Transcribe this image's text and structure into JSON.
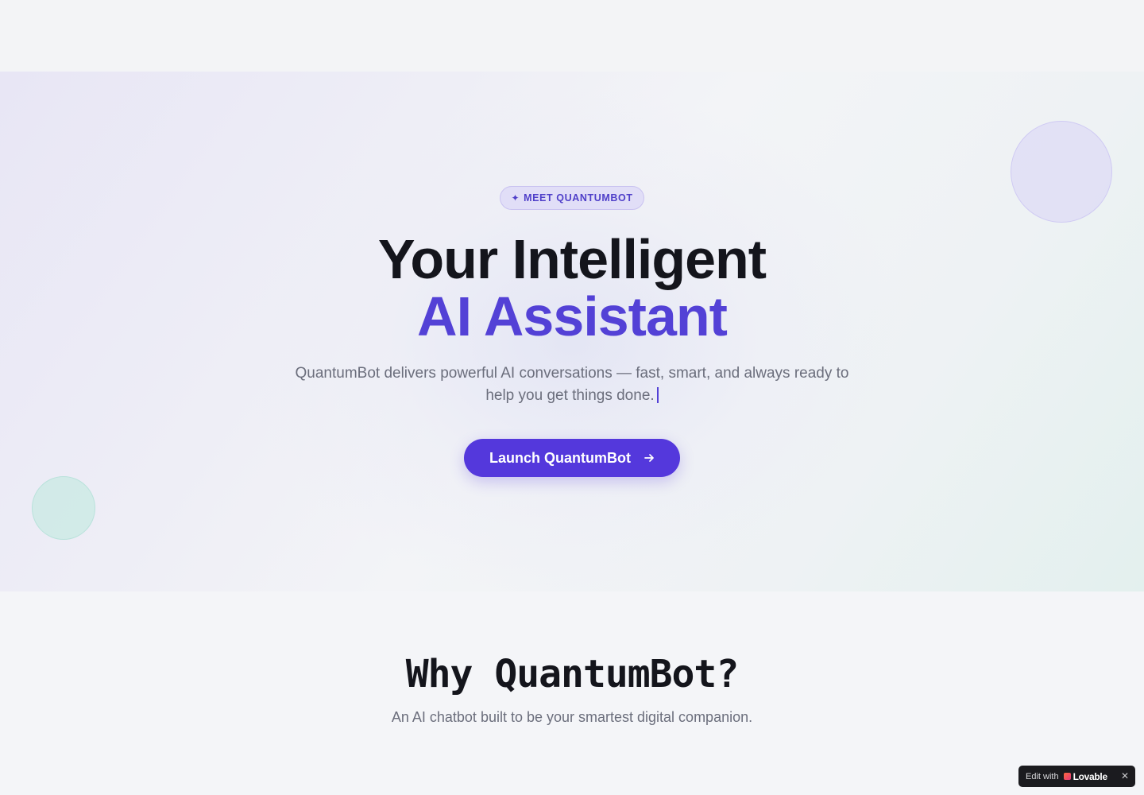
{
  "hero": {
    "badge": "MEET QUANTUMBOT",
    "badge_icon": "sparkle-icon",
    "title_line1": "Your Intelligent",
    "title_line2": "AI Assistant",
    "subtitle": "QuantumBot delivers powerful AI conversations — fast, smart, and always ready to help you get things done.",
    "cta_label": "Launch QuantumBot",
    "cta_icon": "arrow-right-icon"
  },
  "why": {
    "title": "Why QuantumBot?",
    "subtitle": "An AI chatbot built to be your smartest digital companion."
  },
  "lovable_badge": {
    "prefix": "Edit with",
    "brand": "Lovable",
    "close": "✕"
  },
  "colors": {
    "accent": "#5341d6",
    "button": "#5438dc",
    "text_dark": "#14151c",
    "text_muted": "#6b6e7c"
  }
}
